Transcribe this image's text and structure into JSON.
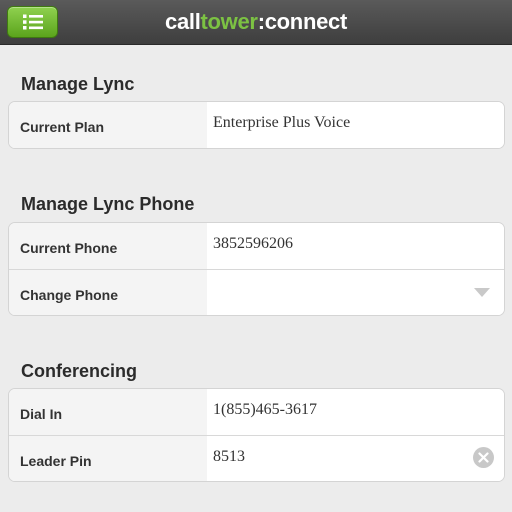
{
  "header": {
    "logo_part1": "call",
    "logo_part2": "tower",
    "logo_part3": ":connect",
    "menu_icon": "list-menu-icon",
    "accent_color": "#7cc243"
  },
  "sections": {
    "manage_lync": {
      "title": "Manage Lync",
      "rows": [
        {
          "label": "Current Plan",
          "value": "Enterprise Plus Voice"
        }
      ]
    },
    "manage_lync_phone": {
      "title": "Manage Lync Phone",
      "rows": [
        {
          "label": "Current Phone",
          "value": "3852596206"
        },
        {
          "label": "Change Phone",
          "value": ""
        }
      ]
    },
    "conferencing": {
      "title": "Conferencing",
      "rows": [
        {
          "label": "Dial In",
          "value": "1(855)465-3617"
        },
        {
          "label": "Leader Pin",
          "value": "8513"
        }
      ]
    }
  },
  "icons": {
    "dropdown": "chevron-down-icon",
    "clear": "clear-icon"
  }
}
